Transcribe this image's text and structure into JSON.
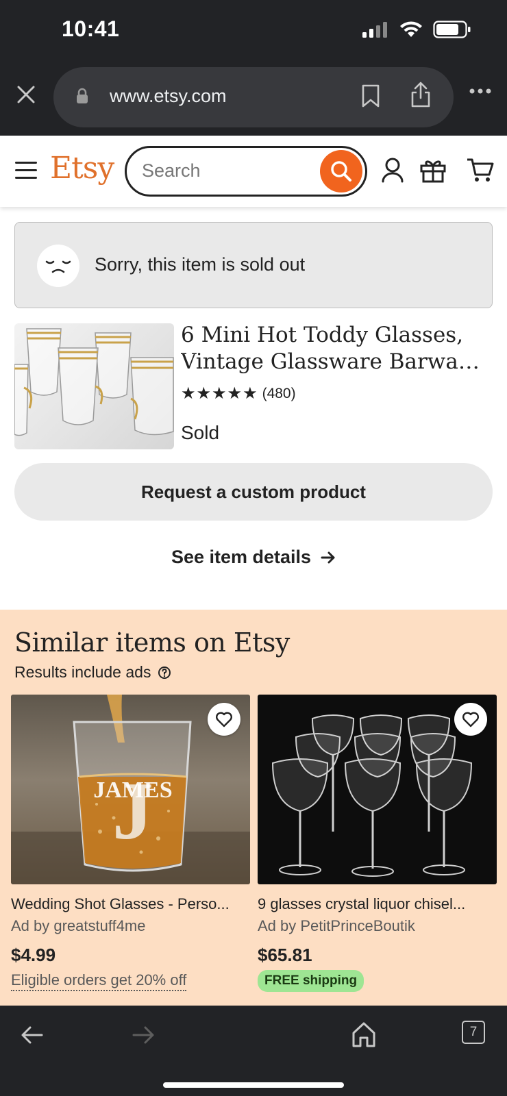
{
  "status_bar": {
    "time": "10:41",
    "signal_icon": "cellular-signal-icon",
    "wifi_icon": "wifi-icon",
    "battery_icon": "battery-icon"
  },
  "browser": {
    "url": "www.etsy.com",
    "close_icon": "close-icon",
    "lock_icon": "lock-icon",
    "bookmark_icon": "bookmark-icon",
    "share_icon": "share-icon",
    "more_icon": "more-icon",
    "tab_count": "7"
  },
  "header": {
    "logo": "Etsy",
    "search_placeholder": "Search",
    "menu_icon": "hamburger-menu-icon",
    "account_icon": "account-icon",
    "gift_icon": "gift-icon",
    "cart_icon": "cart-icon",
    "accent_color": "#f1641e",
    "logo_color": "#e0712c"
  },
  "sold_out": {
    "message": "Sorry, this item is sold out",
    "icon": "sad-face-icon"
  },
  "product": {
    "title_line1": "6 Mini Hot Toddy Glasses,",
    "title_line2": "Vintage Glassware Barware,...",
    "stars": "★★★★★",
    "rating_value": 5,
    "review_count": "(480)",
    "status": "Sold"
  },
  "actions": {
    "custom_product": "Request a custom product",
    "see_details": "See item details"
  },
  "similar": {
    "title": "Similar items on Etsy",
    "ads_note": "Results include ads",
    "background": "#fddec3",
    "items": [
      {
        "title": "Wedding Shot Glasses - Perso...",
        "seller": "Ad by greatstuff4me",
        "price": "$4.99",
        "promo": "Eligible orders get 20% off",
        "image_text_top": "JAMES",
        "image_text_monogram": "J"
      },
      {
        "title": "9 glasses crystal liquor chisel...",
        "seller": "Ad by PetitPrinceBoutik",
        "price": "$65.81",
        "badge": "FREE shipping"
      }
    ]
  }
}
